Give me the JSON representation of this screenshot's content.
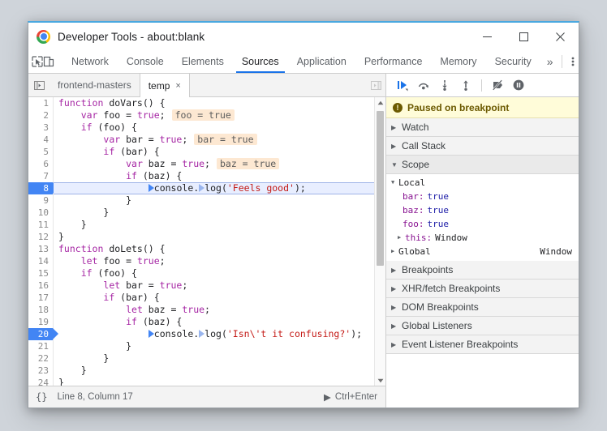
{
  "window": {
    "title": "Developer Tools - about:blank",
    "logo_icon": "chrome-logo",
    "controls": {
      "minimize": "minimize-icon",
      "maximize": "maximize-icon",
      "close": "close-icon"
    }
  },
  "toolbar": {
    "inspect_icon": "inspect-element-icon",
    "device_icon": "device-toolbar-icon",
    "tabs": [
      {
        "label": "Network",
        "selected": false
      },
      {
        "label": "Console",
        "selected": false
      },
      {
        "label": "Elements",
        "selected": false
      },
      {
        "label": "Sources",
        "selected": true
      },
      {
        "label": "Application",
        "selected": false
      },
      {
        "label": "Performance",
        "selected": false
      },
      {
        "label": "Memory",
        "selected": false
      },
      {
        "label": "Security",
        "selected": false
      }
    ],
    "more_tabs": "»",
    "kebab_icon": "more-options-icon",
    "accent_color": "#1a73e8"
  },
  "file_tabs": {
    "navigator_toggle_icon": "show-navigator-icon",
    "panel_toggle_icon": "show-debugger-icon",
    "tabs": [
      {
        "label": "frontend-masters",
        "selected": false,
        "closable": false
      },
      {
        "label": "temp",
        "selected": true,
        "closable": true,
        "close_glyph": "×"
      }
    ]
  },
  "debugger_controls": [
    {
      "name": "resume-script-execution",
      "icon": "resume-icon"
    },
    {
      "name": "step-over-next-function-call",
      "icon": "step-over-icon"
    },
    {
      "name": "step-into-next-function-call",
      "icon": "step-into-icon"
    },
    {
      "name": "step-out-of-current-function",
      "icon": "step-out-icon"
    },
    {
      "name": "deactivate-breakpoints",
      "icon": "deactivate-breakpoints-icon"
    },
    {
      "name": "pause-on-exceptions",
      "icon": "pause-on-exceptions-icon"
    }
  ],
  "editor": {
    "lines": [
      {
        "n": "1",
        "indent": 0,
        "bp": false,
        "current": false,
        "pill": "",
        "tokens": [
          {
            "t": "function",
            "c": "kw"
          },
          {
            "t": " doVars() {",
            "c": ""
          }
        ]
      },
      {
        "n": "2",
        "indent": 1,
        "bp": false,
        "current": false,
        "pill": "foo = true",
        "tokens": [
          {
            "t": "var",
            "c": "kw"
          },
          {
            "t": " foo = ",
            "c": ""
          },
          {
            "t": "true",
            "c": "kw"
          },
          {
            "t": ";",
            "c": ""
          }
        ]
      },
      {
        "n": "3",
        "indent": 1,
        "bp": false,
        "current": false,
        "pill": "",
        "tokens": [
          {
            "t": "if",
            "c": "kw"
          },
          {
            "t": " (foo) {",
            "c": ""
          }
        ]
      },
      {
        "n": "4",
        "indent": 2,
        "bp": false,
        "current": false,
        "pill": "bar = true",
        "tokens": [
          {
            "t": "var",
            "c": "kw"
          },
          {
            "t": " bar = ",
            "c": ""
          },
          {
            "t": "true",
            "c": "kw"
          },
          {
            "t": ";",
            "c": ""
          }
        ]
      },
      {
        "n": "5",
        "indent": 2,
        "bp": false,
        "current": false,
        "pill": "",
        "tokens": [
          {
            "t": "if",
            "c": "kw"
          },
          {
            "t": " (bar) {",
            "c": ""
          }
        ]
      },
      {
        "n": "6",
        "indent": 3,
        "bp": false,
        "current": false,
        "pill": "baz = true",
        "tokens": [
          {
            "t": "var",
            "c": "kw"
          },
          {
            "t": " baz = ",
            "c": ""
          },
          {
            "t": "true",
            "c": "kw"
          },
          {
            "t": ";",
            "c": ""
          }
        ]
      },
      {
        "n": "7",
        "indent": 3,
        "bp": false,
        "current": false,
        "pill": "",
        "tokens": [
          {
            "t": "if",
            "c": "kw"
          },
          {
            "t": " (baz) {",
            "c": ""
          }
        ]
      },
      {
        "n": "8",
        "indent": 4,
        "bp": true,
        "current": true,
        "pill": "",
        "marker": "both",
        "tokens": [
          {
            "t": "console.",
            "c": ""
          },
          {
            "t": "log(",
            "c": ""
          },
          {
            "t": "'Feels good'",
            "c": "str"
          },
          {
            "t": ");",
            "c": ""
          }
        ]
      },
      {
        "n": "9",
        "indent": 3,
        "bp": false,
        "current": false,
        "pill": "",
        "tokens": [
          {
            "t": "}",
            "c": ""
          }
        ]
      },
      {
        "n": "10",
        "indent": 2,
        "bp": false,
        "current": false,
        "pill": "",
        "tokens": [
          {
            "t": "}",
            "c": ""
          }
        ]
      },
      {
        "n": "11",
        "indent": 1,
        "bp": false,
        "current": false,
        "pill": "",
        "tokens": [
          {
            "t": "}",
            "c": ""
          }
        ]
      },
      {
        "n": "12",
        "indent": 0,
        "bp": false,
        "current": false,
        "pill": "",
        "tokens": [
          {
            "t": "}",
            "c": ""
          }
        ]
      },
      {
        "n": "13",
        "indent": 0,
        "bp": false,
        "current": false,
        "pill": "",
        "tokens": [
          {
            "t": "function",
            "c": "kw"
          },
          {
            "t": " doLets() {",
            "c": ""
          }
        ]
      },
      {
        "n": "14",
        "indent": 1,
        "bp": false,
        "current": false,
        "pill": "",
        "tokens": [
          {
            "t": "let",
            "c": "kw"
          },
          {
            "t": " foo = ",
            "c": ""
          },
          {
            "t": "true",
            "c": "kw"
          },
          {
            "t": ";",
            "c": ""
          }
        ]
      },
      {
        "n": "15",
        "indent": 1,
        "bp": false,
        "current": false,
        "pill": "",
        "tokens": [
          {
            "t": "if",
            "c": "kw"
          },
          {
            "t": " (foo) {",
            "c": ""
          }
        ]
      },
      {
        "n": "16",
        "indent": 2,
        "bp": false,
        "current": false,
        "pill": "",
        "tokens": [
          {
            "t": "let",
            "c": "kw"
          },
          {
            "t": " bar = ",
            "c": ""
          },
          {
            "t": "true",
            "c": "kw"
          },
          {
            "t": ";",
            "c": ""
          }
        ]
      },
      {
        "n": "17",
        "indent": 2,
        "bp": false,
        "current": false,
        "pill": "",
        "tokens": [
          {
            "t": "if",
            "c": "kw"
          },
          {
            "t": " (bar) {",
            "c": ""
          }
        ]
      },
      {
        "n": "18",
        "indent": 3,
        "bp": false,
        "current": false,
        "pill": "",
        "tokens": [
          {
            "t": "let",
            "c": "kw"
          },
          {
            "t": " baz = ",
            "c": ""
          },
          {
            "t": "true",
            "c": "kw"
          },
          {
            "t": ";",
            "c": ""
          }
        ]
      },
      {
        "n": "19",
        "indent": 3,
        "bp": false,
        "current": false,
        "pill": "",
        "tokens": [
          {
            "t": "if",
            "c": "kw"
          },
          {
            "t": " (baz) {",
            "c": ""
          }
        ]
      },
      {
        "n": "20",
        "indent": 4,
        "bp": true,
        "current": false,
        "pill": "",
        "marker": "both",
        "tokens": [
          {
            "t": "console.",
            "c": ""
          },
          {
            "t": "log(",
            "c": ""
          },
          {
            "t": "'Isn\\'t it confusing?'",
            "c": "str"
          },
          {
            "t": ");",
            "c": ""
          }
        ]
      },
      {
        "n": "21",
        "indent": 3,
        "bp": false,
        "current": false,
        "pill": "",
        "tokens": [
          {
            "t": "}",
            "c": ""
          }
        ]
      },
      {
        "n": "22",
        "indent": 2,
        "bp": false,
        "current": false,
        "pill": "",
        "tokens": [
          {
            "t": "}",
            "c": ""
          }
        ]
      },
      {
        "n": "23",
        "indent": 1,
        "bp": false,
        "current": false,
        "pill": "",
        "tokens": [
          {
            "t": "}",
            "c": ""
          }
        ]
      },
      {
        "n": "24",
        "indent": 0,
        "bp": false,
        "current": false,
        "pill": "",
        "tokens": [
          {
            "t": "}",
            "c": ""
          }
        ]
      }
    ],
    "scrollbar": {
      "up_arrow": "▲",
      "down_arrow": "▼",
      "thumb_pct": 58
    },
    "colors": {
      "keyword": "#a626a4",
      "string": "#c41a16",
      "pill_bg": "#fde8d2",
      "current_line_bg": "#e8eeff",
      "breakpoint": "#4285f4"
    }
  },
  "statusbar": {
    "format_icon": "{}",
    "position": "Line 8, Column 17",
    "run_glyph": "▶",
    "run_label": "Ctrl+Enter"
  },
  "sidebar": {
    "paused_banner": {
      "icon": "info-icon",
      "icon_glyph": "!",
      "text": "Paused on breakpoint",
      "bg": "#fffcd9",
      "fg": "#6b5900"
    },
    "sections": [
      {
        "label": "Watch",
        "expanded": false
      },
      {
        "label": "Call Stack",
        "expanded": false
      },
      {
        "label": "Scope",
        "expanded": true
      }
    ],
    "scope": {
      "local": {
        "label": "Local",
        "expanded": true,
        "vars": [
          {
            "name": "bar:",
            "value": "true",
            "expandable": false
          },
          {
            "name": "baz:",
            "value": "true",
            "expandable": false
          },
          {
            "name": "foo:",
            "value": "true",
            "expandable": false
          },
          {
            "name": "this:",
            "value": "Window",
            "expandable": true
          }
        ]
      },
      "global": {
        "label": "Global",
        "expanded": false,
        "value": "Window"
      }
    },
    "lower_sections": [
      {
        "label": "Breakpoints",
        "expanded": false
      },
      {
        "label": "XHR/fetch Breakpoints",
        "expanded": false
      },
      {
        "label": "DOM Breakpoints",
        "expanded": false
      },
      {
        "label": "Global Listeners",
        "expanded": false
      },
      {
        "label": "Event Listener Breakpoints",
        "expanded": false
      }
    ],
    "triangle_closed": "▶",
    "triangle_open": "▼"
  }
}
